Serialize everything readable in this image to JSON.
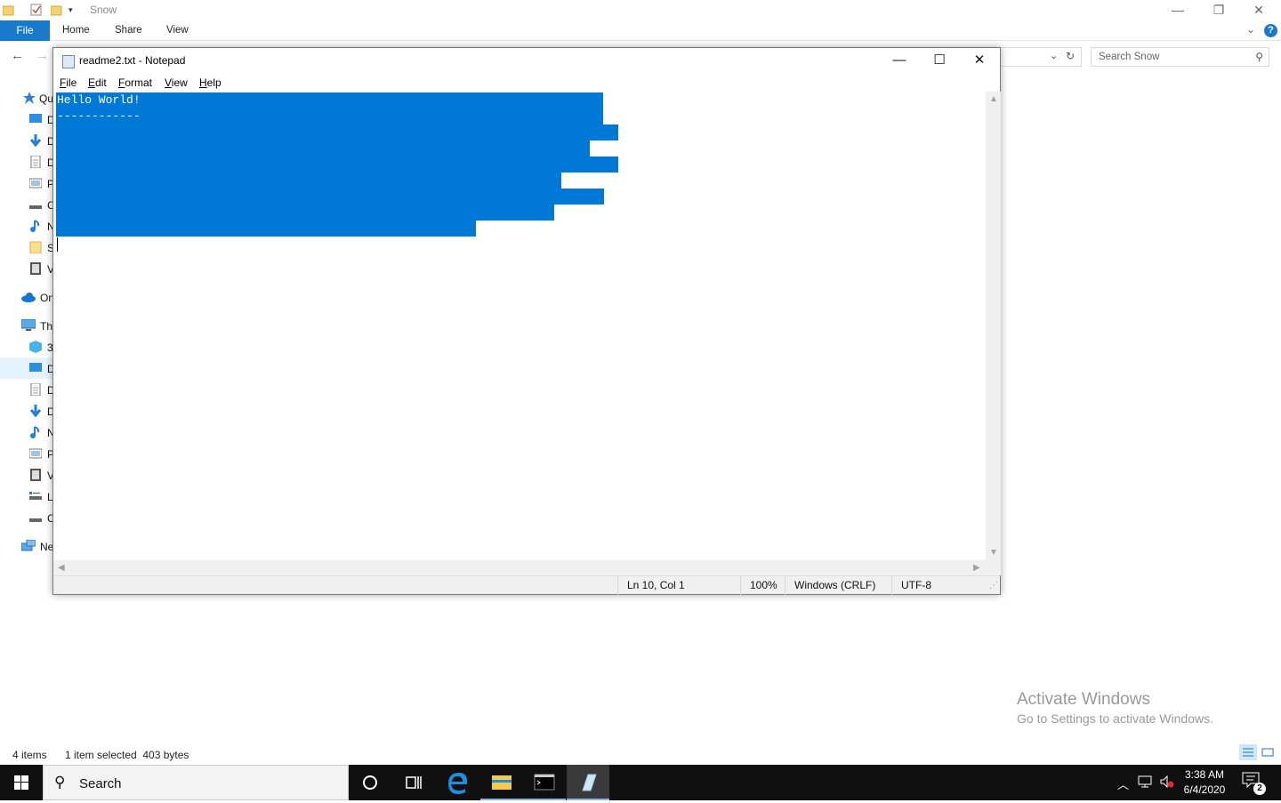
{
  "explorer": {
    "title": "Snow",
    "ribbon": {
      "file": "File",
      "home": "Home",
      "share": "Share",
      "view": "View",
      "help": "?"
    },
    "search_placeholder": "Search Snow",
    "nav_items": [
      {
        "label": "Qu",
        "icon": "star-icon"
      },
      {
        "label": "D",
        "icon": "desktop-icon"
      },
      {
        "label": "D",
        "icon": "download-icon"
      },
      {
        "label": "D",
        "icon": "document-icon"
      },
      {
        "label": "P",
        "icon": "pictures-icon"
      },
      {
        "label": "C",
        "icon": "drive-icon"
      },
      {
        "label": "N",
        "icon": "music-icon"
      },
      {
        "label": "S",
        "icon": "folder-icon"
      },
      {
        "label": "V",
        "icon": "video-icon"
      },
      {
        "label": "On",
        "icon": "onedrive-icon"
      },
      {
        "label": "Thi",
        "icon": "this-pc-icon"
      },
      {
        "label": "3",
        "icon": "3d-objects-icon"
      },
      {
        "label": "D",
        "icon": "desktop-icon"
      },
      {
        "label": "D",
        "icon": "document-icon"
      },
      {
        "label": "D",
        "icon": "download-icon"
      },
      {
        "label": "N",
        "icon": "music-icon"
      },
      {
        "label": "P",
        "icon": "pictures-icon"
      },
      {
        "label": "V",
        "icon": "video-icon"
      },
      {
        "label": "L",
        "icon": "local-disk-icon"
      },
      {
        "label": "C",
        "icon": "drive-icon"
      },
      {
        "label": "Ne",
        "icon": "network-icon"
      }
    ],
    "status": {
      "items": "4 items",
      "selection": "1 item selected  403 bytes"
    },
    "watermark": {
      "title": "Activate Windows",
      "subtitle": "Go to Settings to activate Windows."
    }
  },
  "notepad": {
    "title": "readme2.txt - Notepad",
    "menu": [
      {
        "key": "F",
        "rest": "ile"
      },
      {
        "key": "E",
        "rest": "dit"
      },
      {
        "key": "F",
        "rest": "ormat"
      },
      {
        "key": "V",
        "rest": "iew"
      },
      {
        "key": "H",
        "rest": "elp"
      }
    ],
    "lines": [
      "Hello World!",
      "------------",
      "",
      "",
      "",
      "",
      "",
      "",
      ""
    ],
    "status": {
      "position": "Ln 10, Col 1",
      "zoom": "100%",
      "line_ending": "Windows (CRLF)",
      "encoding": "UTF-8"
    }
  },
  "taskbar": {
    "search": "Search",
    "time": "3:38 AM",
    "date": "6/4/2020",
    "notifications": "2"
  },
  "colors": {
    "selection": "#0078d7",
    "ribbon_file": "#1979ca",
    "taskbar": "#101010"
  }
}
